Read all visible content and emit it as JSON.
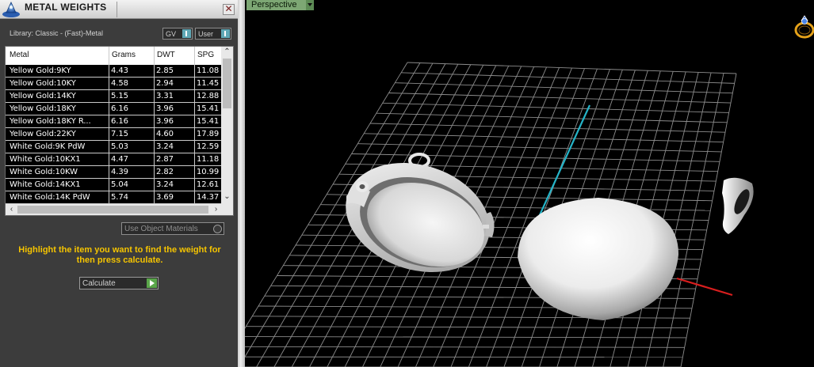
{
  "panel": {
    "title": "METAL WEIGHTS",
    "close_glyph": "✕",
    "library_label": "Library: Classic - (Fast)-Metal",
    "gv_combo": "GV",
    "user_combo": "User",
    "use_object_materials": "Use Object Materials",
    "instructions": "Highlight the item you want to find the weight for then press calculate.",
    "calculate_label": "Calculate",
    "icons": {
      "app": "app-logo-icon",
      "close": "close-icon",
      "combo": "dropdown-icon",
      "calc": "play-arrow-icon"
    }
  },
  "table": {
    "headers": [
      "Metal",
      "Grams",
      "DWT",
      "SPG"
    ],
    "rows": [
      [
        "Yellow Gold:9KY",
        "4.43",
        "2.85",
        "11.08"
      ],
      [
        "Yellow Gold:10KY",
        "4.58",
        "2.94",
        "11.45"
      ],
      [
        "Yellow Gold:14KY",
        "5.15",
        "3.31",
        "12.88"
      ],
      [
        "Yellow Gold:18KY",
        "6.16",
        "3.96",
        "15.41"
      ],
      [
        "Yellow Gold:18KY R...",
        "6.16",
        "3.96",
        "15.41"
      ],
      [
        "Yellow Gold:22KY",
        "7.15",
        "4.60",
        "17.89"
      ],
      [
        "White Gold:9K PdW",
        "5.03",
        "3.24",
        "12.59"
      ],
      [
        "White Gold:10KX1",
        "4.47",
        "2.87",
        "11.18"
      ],
      [
        "White Gold:10KW",
        "4.39",
        "2.82",
        "10.99"
      ],
      [
        "White Gold:14KX1",
        "5.04",
        "3.24",
        "12.61"
      ],
      [
        "White Gold:14K PdW",
        "5.74",
        "3.69",
        "14.37"
      ]
    ]
  },
  "viewport": {
    "label": "Perspective",
    "icons": {
      "dropdown": "chevron-down-icon",
      "navigator": "ring-navigator-icon"
    },
    "colors": {
      "grid": "#8c8c8c",
      "y_axis": "#25b4c8",
      "x_axis": "#d81e1e",
      "background": "#000000"
    }
  },
  "colors": {
    "instruction_text": "#f5c400",
    "panel_bg": "#3c3c3c",
    "accent_button": "#5aa64a"
  }
}
